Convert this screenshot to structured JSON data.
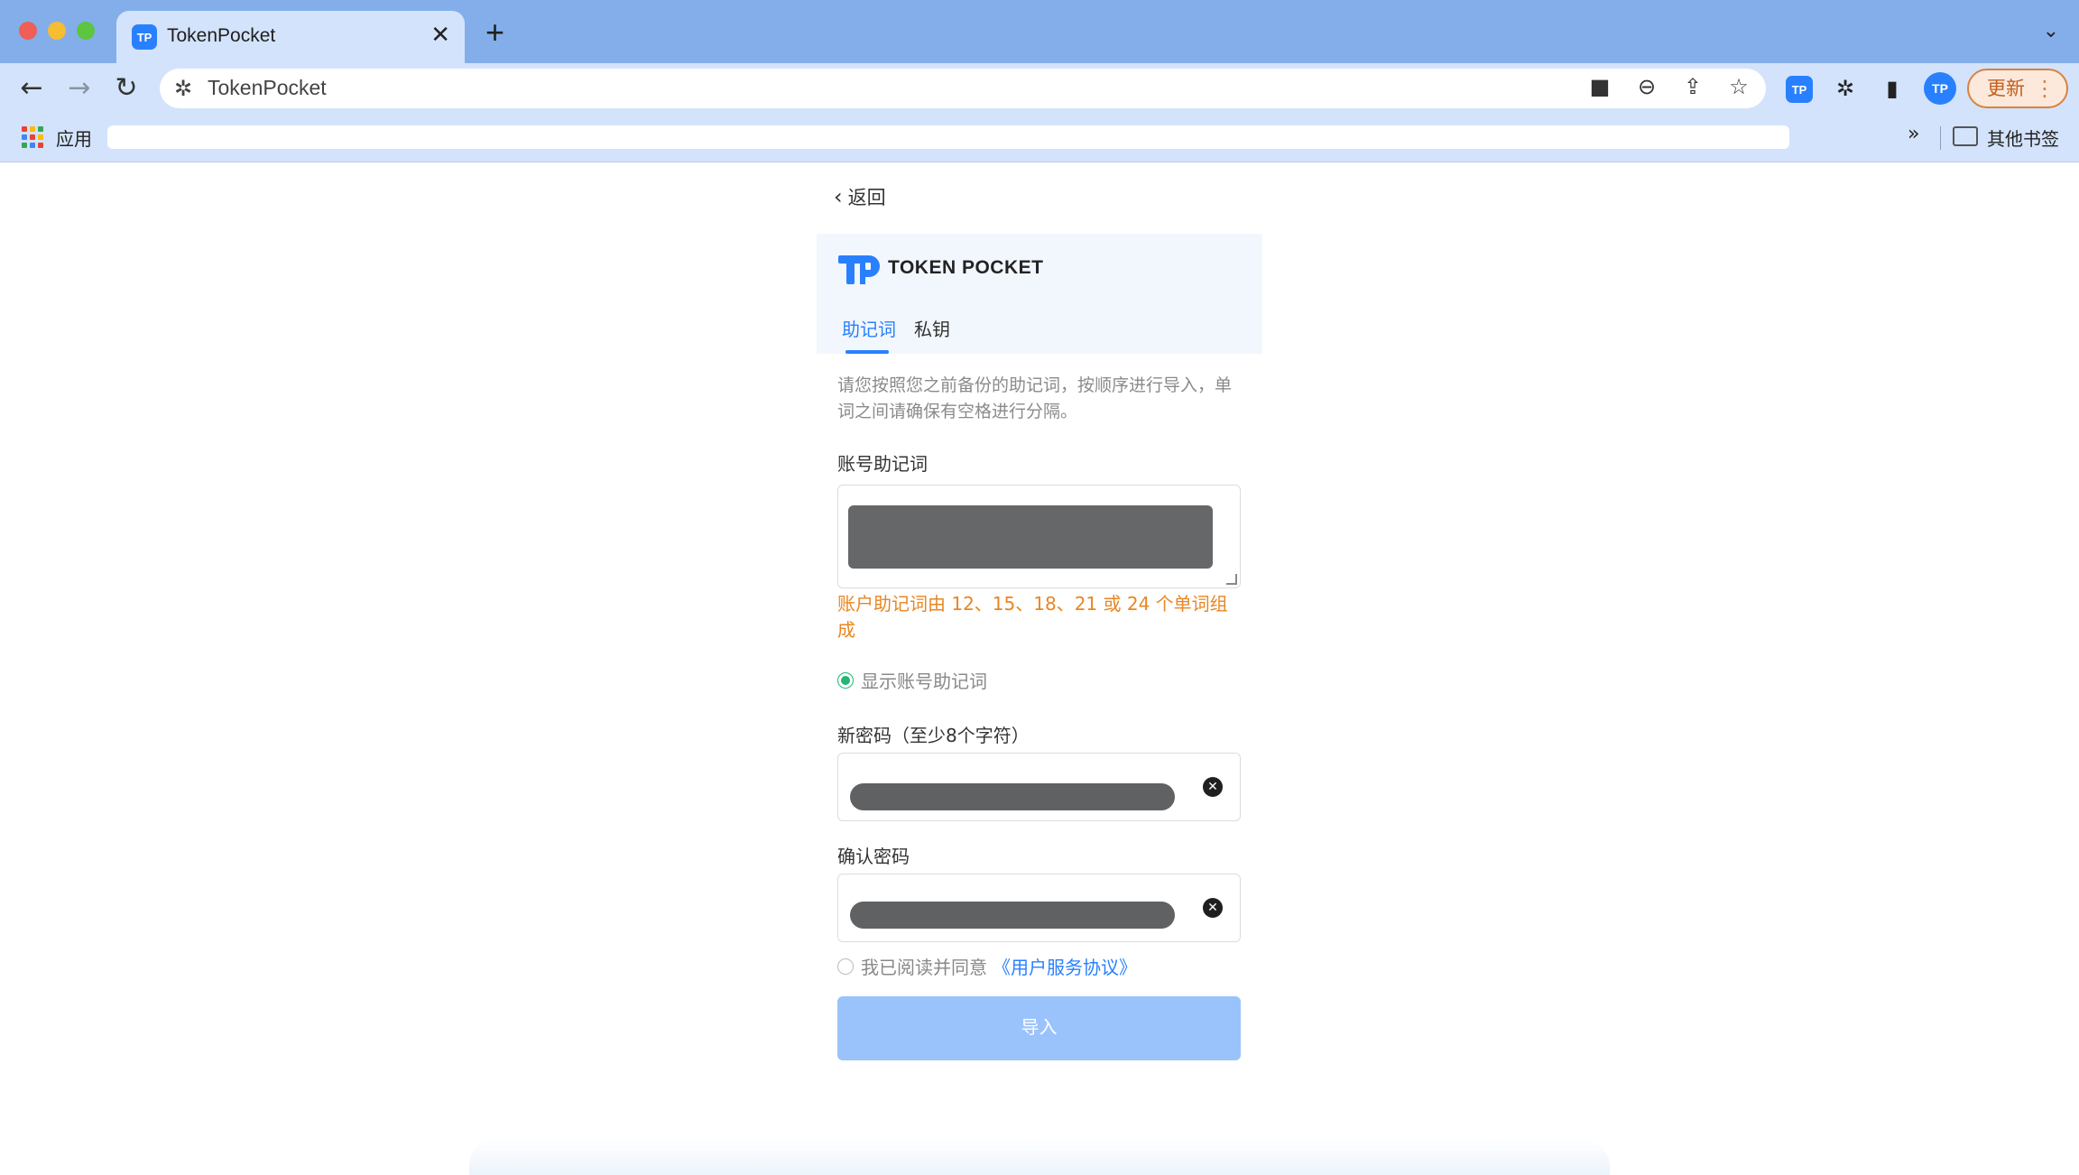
{
  "browser": {
    "tab_title": "TokenPocket",
    "tab_favicon_text": "TP",
    "tab_close": "✕",
    "new_tab": "+",
    "omnibox_text": "TokenPocket",
    "update_label": "更新",
    "profile_text": "TP",
    "bookmarks": {
      "apps_label": "应用",
      "more": "»",
      "other_label": "其他书签"
    }
  },
  "page": {
    "back_label": "返回",
    "logo_text": "TOKEN POCKET",
    "tabs": [
      {
        "label": "助记词",
        "active": true
      },
      {
        "label": "私钥",
        "active": false
      }
    ],
    "hint": "请您按照您之前备份的助记词，按顺序进行导入，单词之间请确保有空格进行分隔。",
    "mnemonic_label": "账号助记词",
    "mnemonic_error": "账户助记词由 12、15、18、21 或 24 个单词组成",
    "show_mnemonic_label": "显示账号助记词",
    "new_password_label": "新密码（至少8个字符）",
    "confirm_password_label": "确认密码",
    "agree_prefix": "我已阅读并同意",
    "agree_link": "《用户服务协议》",
    "import_button": "导入"
  },
  "colors": {
    "accent": "#2980fe",
    "error": "#e88622",
    "success": "#22b573",
    "button_disabled": "#9ac3fb"
  }
}
